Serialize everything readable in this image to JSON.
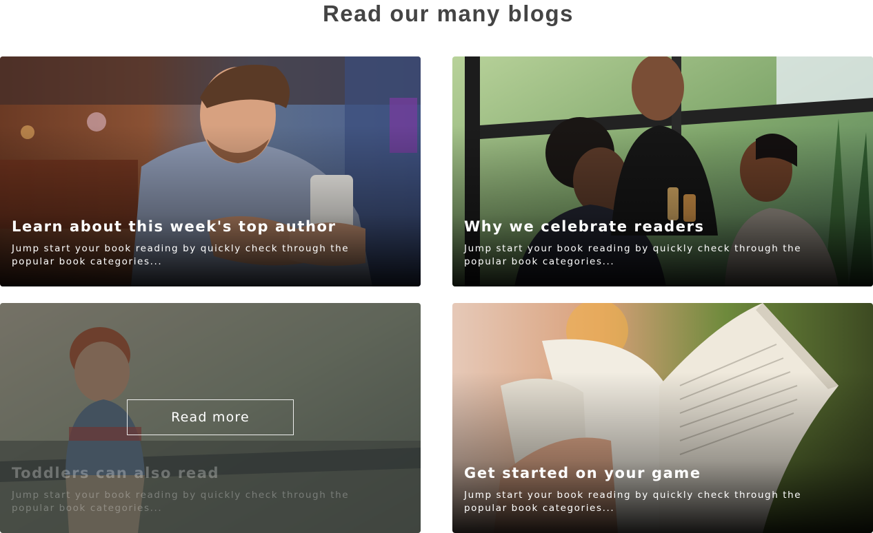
{
  "section": {
    "title": "Read our many blogs"
  },
  "cards": [
    {
      "title": "Learn about this week's top author",
      "excerpt": "Jump start your book reading by quickly check through the popular book categories..."
    },
    {
      "title": "Why we celebrate readers",
      "excerpt": "Jump start your book reading by quickly check through the popular book categories..."
    },
    {
      "title": "Toddlers can also read",
      "excerpt": "Jump start your book reading by quickly check through the popular book categories...",
      "hover_button_label": "Read more"
    },
    {
      "title": "Get started on your game",
      "excerpt": "Jump start your book reading by quickly check through the popular book categories..."
    }
  ],
  "colors": {
    "title_text": "#444444",
    "card_text": "#ffffff"
  }
}
